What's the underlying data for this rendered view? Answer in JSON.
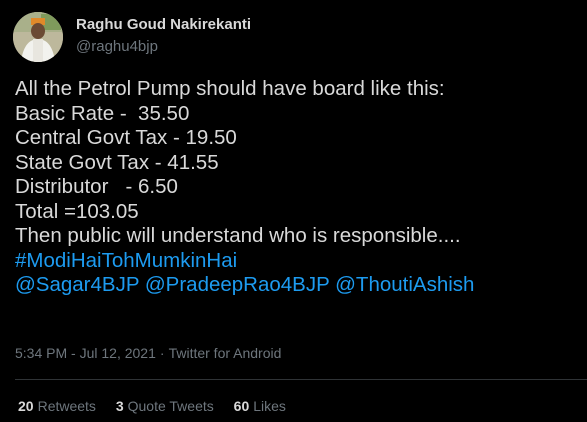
{
  "author": {
    "name": "Raghu Goud Nakirekanti",
    "handle": "@raghu4bjp"
  },
  "tweet": {
    "lines": [
      "All the Petrol Pump should have board like this:",
      "Basic Rate -  35.50",
      "Central Govt Tax - 19.50",
      "State Govt Tax - 41.55",
      "Distributor   - 6.50",
      "Total =103.05",
      "Then public will understand who is responsible...."
    ],
    "hashtag": "#ModiHaiTohMumkinHai",
    "mentions": [
      "@Sagar4BJP",
      "@PradeepRao4BJP",
      "@ThoutiAshish"
    ]
  },
  "meta": {
    "time": "5:34 PM",
    "separator": "·",
    "date": "Jul 12, 2021",
    "source": "Twitter for Android"
  },
  "stats": {
    "retweets_count": "20",
    "retweets_label": "Retweets",
    "quotes_count": "3",
    "quotes_label": "Quote Tweets",
    "likes_count": "60",
    "likes_label": "Likes"
  },
  "colors": {
    "background": "#000000",
    "text": "#d9d9d9",
    "secondary": "#6e767d",
    "link": "#1d9bf0",
    "divider": "#2f3336"
  }
}
